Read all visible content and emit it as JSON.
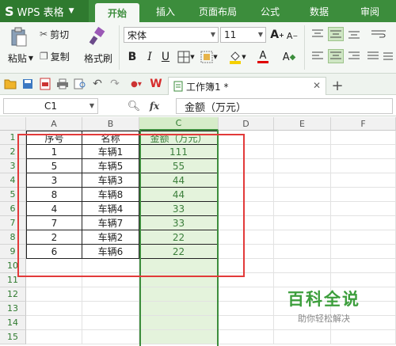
{
  "app": {
    "logo_letter": "S",
    "title": "WPS 表格"
  },
  "tabs": [
    {
      "label": "开始",
      "active": true
    },
    {
      "label": "插入"
    },
    {
      "label": "页面布局"
    },
    {
      "label": "公式"
    },
    {
      "label": "数据"
    },
    {
      "label": "审阅"
    }
  ],
  "ribbon": {
    "paste": "粘贴",
    "cut": "剪切",
    "copy": "复制",
    "format_painter": "格式刷",
    "font_name": "宋体",
    "font_size": "11",
    "bold": "B",
    "italic": "I",
    "underline": "U",
    "grow_font": "A",
    "shrink_font": "A",
    "font_color_letter": "A",
    "clear_format_letter": "A"
  },
  "document": {
    "tab_title": "工作簿1 *"
  },
  "formula_bar": {
    "name_box": "C1",
    "fx": "fx",
    "value": "金额（万元）"
  },
  "grid": {
    "columns": [
      "A",
      "B",
      "C",
      "D",
      "E",
      "F"
    ],
    "rows": [
      "1",
      "2",
      "3",
      "4",
      "5",
      "6",
      "7",
      "8",
      "9",
      "10",
      "11",
      "12",
      "13",
      "14",
      "15"
    ],
    "data": [
      [
        "序号",
        "名称",
        "金额（万元）"
      ],
      [
        "1",
        "车辆1",
        "111"
      ],
      [
        "5",
        "车辆5",
        "55"
      ],
      [
        "3",
        "车辆3",
        "44"
      ],
      [
        "8",
        "车辆8",
        "44"
      ],
      [
        "4",
        "车辆4",
        "33"
      ],
      [
        "7",
        "车辆7",
        "33"
      ],
      [
        "2",
        "车辆2",
        "22"
      ],
      [
        "6",
        "车辆6",
        "22"
      ]
    ]
  },
  "watermark": {
    "title": "百科全说",
    "subtitle": "助你轻松解决"
  },
  "colors": {
    "accent": "#3c8d3c",
    "selection_fill": "#e4f3dc",
    "annotation": "#e23a3a"
  }
}
